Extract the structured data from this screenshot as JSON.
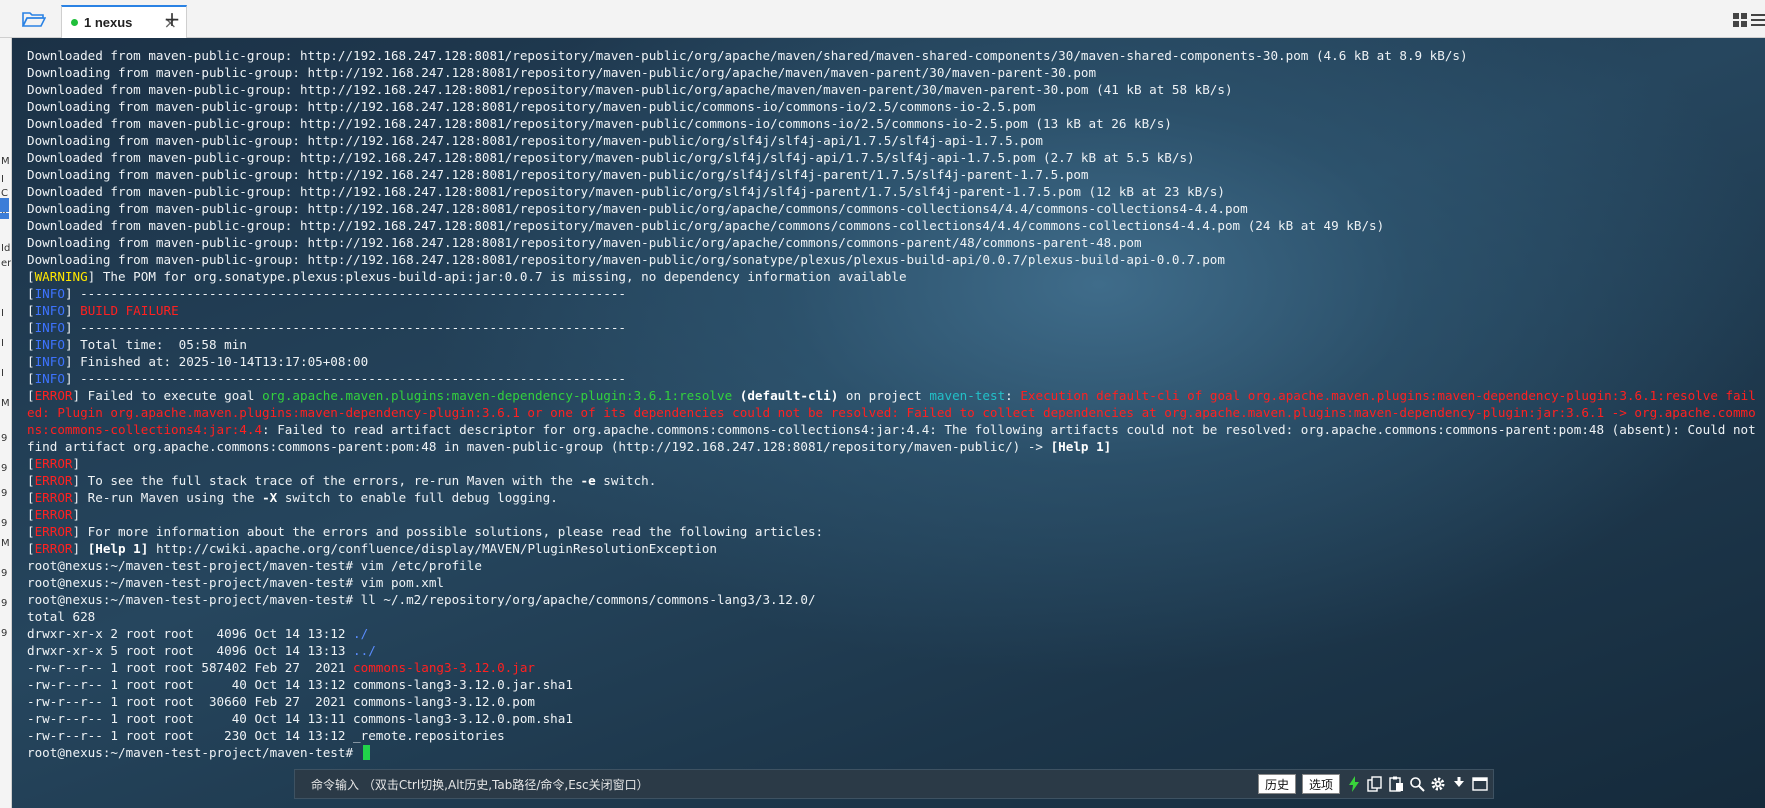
{
  "tabbar": {
    "tab_label": "1 nexus",
    "close_glyph": "×",
    "add_glyph": "+",
    "icons": [
      "folder-open-icon",
      "tab-status-dot-icon",
      "grid-layout-icon",
      "list-menu-icon"
    ]
  },
  "side_strip": [
    "M",
    "I",
    "C",
    "4",
    "Id",
    "er",
    "I",
    "I",
    "I",
    "M",
    "9",
    "9",
    "9",
    "9",
    "M",
    "9",
    "9",
    "9"
  ],
  "colors": {
    "accent_tab": "#2a82e4",
    "status_dot": "#1fbf3a",
    "error_red": "#ff2020",
    "info_blue": "#3d73ff",
    "warning_yellow": "#ffe600",
    "success_green": "#33d13d",
    "cursor_green": "#21d44a"
  },
  "terminal": {
    "lines": [
      [
        {
          "t": "Downloaded from maven-public-group: http://192.168.247.128:8081/repository/maven-public/org/apache/maven/shared/maven-shared-components/30/maven-shared-components-30.pom (4.6 kB at 8.9 kB/s)"
        }
      ],
      [
        {
          "t": "Downloading from maven-public-group: http://192.168.247.128:8081/repository/maven-public/org/apache/maven/maven-parent/30/maven-parent-30.pom"
        }
      ],
      [
        {
          "t": "Downloaded from maven-public-group: http://192.168.247.128:8081/repository/maven-public/org/apache/maven/maven-parent/30/maven-parent-30.pom (41 kB at 58 kB/s)"
        }
      ],
      [
        {
          "t": "Downloading from maven-public-group: http://192.168.247.128:8081/repository/maven-public/commons-io/commons-io/2.5/commons-io-2.5.pom"
        }
      ],
      [
        {
          "t": "Downloaded from maven-public-group: http://192.168.247.128:8081/repository/maven-public/commons-io/commons-io/2.5/commons-io-2.5.pom (13 kB at 26 kB/s)"
        }
      ],
      [
        {
          "t": "Downloading from maven-public-group: http://192.168.247.128:8081/repository/maven-public/org/slf4j/slf4j-api/1.7.5/slf4j-api-1.7.5.pom"
        }
      ],
      [
        {
          "t": "Downloaded from maven-public-group: http://192.168.247.128:8081/repository/maven-public/org/slf4j/slf4j-api/1.7.5/slf4j-api-1.7.5.pom (2.7 kB at 5.5 kB/s)"
        }
      ],
      [
        {
          "t": "Downloading from maven-public-group: http://192.168.247.128:8081/repository/maven-public/org/slf4j/slf4j-parent/1.7.5/slf4j-parent-1.7.5.pom"
        }
      ],
      [
        {
          "t": "Downloaded from maven-public-group: http://192.168.247.128:8081/repository/maven-public/org/slf4j/slf4j-parent/1.7.5/slf4j-parent-1.7.5.pom (12 kB at 23 kB/s)"
        }
      ],
      [
        {
          "t": "Downloading from maven-public-group: http://192.168.247.128:8081/repository/maven-public/org/apache/commons/commons-collections4/4.4/commons-collections4-4.4.pom"
        }
      ],
      [
        {
          "t": "Downloaded from maven-public-group: http://192.168.247.128:8081/repository/maven-public/org/apache/commons/commons-collections4/4.4/commons-collections4-4.4.pom (24 kB at 49 kB/s)"
        }
      ],
      [
        {
          "t": "Downloading from maven-public-group: http://192.168.247.128:8081/repository/maven-public/org/apache/commons/commons-parent/48/commons-parent-48.pom"
        }
      ],
      [
        {
          "t": "Downloading from maven-public-group: http://192.168.247.128:8081/repository/maven-public/org/sonatype/plexus/plexus-build-api/0.0.7/plexus-build-api-0.0.7.pom"
        }
      ],
      [
        {
          "t": "["
        },
        {
          "t": "WARNING",
          "c": "t-yellow"
        },
        {
          "t": "] The POM for org.sonatype.plexus:plexus-build-api:jar:0.0.7 is missing, no dependency information available"
        }
      ],
      [
        {
          "t": "["
        },
        {
          "t": "INFO",
          "c": "t-blue"
        },
        {
          "t": "] ------------------------------------------------------------------------"
        }
      ],
      [
        {
          "t": "["
        },
        {
          "t": "INFO",
          "c": "t-blue"
        },
        {
          "t": "] "
        },
        {
          "t": "BUILD FAILURE",
          "c": "t-red"
        }
      ],
      [
        {
          "t": "["
        },
        {
          "t": "INFO",
          "c": "t-blue"
        },
        {
          "t": "] ------------------------------------------------------------------------"
        }
      ],
      [
        {
          "t": "["
        },
        {
          "t": "INFO",
          "c": "t-blue"
        },
        {
          "t": "] Total time:  05:58 min"
        }
      ],
      [
        {
          "t": "["
        },
        {
          "t": "INFO",
          "c": "t-blue"
        },
        {
          "t": "] Finished at: 2025-10-14T13:17:05+08:00"
        }
      ],
      [
        {
          "t": "["
        },
        {
          "t": "INFO",
          "c": "t-blue"
        },
        {
          "t": "] ------------------------------------------------------------------------"
        }
      ],
      [
        {
          "t": "["
        },
        {
          "t": "ERROR",
          "c": "t-red"
        },
        {
          "t": "] Failed to execute goal "
        },
        {
          "t": "org.apache.maven.plugins:maven-dependency-plugin:3.6.1:resolve",
          "c": "t-green"
        },
        {
          "t": " "
        },
        {
          "t": "(default-cli)",
          "c": "t-bold"
        },
        {
          "t": " on project "
        },
        {
          "t": "maven-test",
          "c": "t-cyan"
        },
        {
          "t": ": "
        },
        {
          "t": "Execution default-cli of goal org.apache.maven.plugins:maven-dependency-plugin:3.6.1:resolve failed: Plugin org.apache.maven.plugins:maven-dependency-plugin:3.6.1 or one of its dependencies could not be resolved: Failed to collect dependencies at org.apache.maven.plugins:maven-dependency-plugin:jar:3.6.1 -> org.apache.commons:commons-collections4:jar:4.4",
          "c": "t-red"
        },
        {
          "t": ": Failed to read artifact descriptor for org.apache.commons:commons-collections4:jar:4.4: The following artifacts could not be resolved: org.apache.commons:commons-parent:pom:48 (absent): Could not find artifact org.apache.commons:commons-parent:pom:48 in maven-public-group (http://192.168.247.128:8081/repository/maven-public/) -> "
        },
        {
          "t": "[Help 1]",
          "c": "t-bold"
        }
      ],
      [
        {
          "t": "["
        },
        {
          "t": "ERROR",
          "c": "t-red"
        },
        {
          "t": "]"
        }
      ],
      [
        {
          "t": "["
        },
        {
          "t": "ERROR",
          "c": "t-red"
        },
        {
          "t": "] To see the full stack trace of the errors, re-run Maven with the "
        },
        {
          "t": "-e",
          "c": "t-bold"
        },
        {
          "t": " switch."
        }
      ],
      [
        {
          "t": "["
        },
        {
          "t": "ERROR",
          "c": "t-red"
        },
        {
          "t": "] Re-run Maven using the "
        },
        {
          "t": "-X",
          "c": "t-bold"
        },
        {
          "t": " switch to enable full debug logging."
        }
      ],
      [
        {
          "t": "["
        },
        {
          "t": "ERROR",
          "c": "t-red"
        },
        {
          "t": "]"
        }
      ],
      [
        {
          "t": "["
        },
        {
          "t": "ERROR",
          "c": "t-red"
        },
        {
          "t": "] For more information about the errors and possible solutions, please read the following articles:"
        }
      ],
      [
        {
          "t": "["
        },
        {
          "t": "ERROR",
          "c": "t-red"
        },
        {
          "t": "] "
        },
        {
          "t": "[Help 1]",
          "c": "t-bold"
        },
        {
          "t": " http://cwiki.apache.org/confluence/display/MAVEN/PluginResolutionException"
        }
      ],
      [
        {
          "t": "root@nexus:~/maven-test-project/maven-test# vim /etc/profile"
        }
      ],
      [
        {
          "t": "root@nexus:~/maven-test-project/maven-test# vim pom.xml"
        }
      ],
      [
        {
          "t": "root@nexus:~/maven-test-project/maven-test# ll ~/.m2/repository/org/apache/commons/commons-lang3/3.12.0/"
        }
      ],
      [
        {
          "t": "total 628"
        }
      ],
      [
        {
          "t": "drwxr-xr-x 2 root root   4096 Oct 14 13:12 "
        },
        {
          "t": "./",
          "c": "t-dirblue"
        }
      ],
      [
        {
          "t": "drwxr-xr-x 5 root root   4096 Oct 14 13:13 "
        },
        {
          "t": "../",
          "c": "t-dirblue"
        }
      ],
      [
        {
          "t": "-rw-r--r-- 1 root root 587402 Feb 27  2021 "
        },
        {
          "t": "commons-lang3-3.12.0.jar",
          "c": "t-red"
        }
      ],
      [
        {
          "t": "-rw-r--r-- 1 root root     40 Oct 14 13:12 commons-lang3-3.12.0.jar.sha1"
        }
      ],
      [
        {
          "t": "-rw-r--r-- 1 root root  30660 Feb 27  2021 commons-lang3-3.12.0.pom"
        }
      ],
      [
        {
          "t": "-rw-r--r-- 1 root root     40 Oct 14 13:11 commons-lang3-3.12.0.pom.sha1"
        }
      ],
      [
        {
          "t": "-rw-r--r-- 1 root root    230 Oct 14 13:12 _remote.repositories"
        }
      ],
      [
        {
          "t": "root@nexus:~/maven-test-project/maven-test# "
        }
      ]
    ]
  },
  "cmdbar": {
    "prompt": "命令输入 （双击Ctrl切换,Alt历史,Tab路径/命令,Esc关闭窗口）",
    "history_label": "历史",
    "options_label": "选项",
    "icons": [
      "lightning-icon",
      "copy-icon",
      "paste-icon",
      "search-icon",
      "gear-icon",
      "download-icon",
      "window-icon"
    ]
  }
}
